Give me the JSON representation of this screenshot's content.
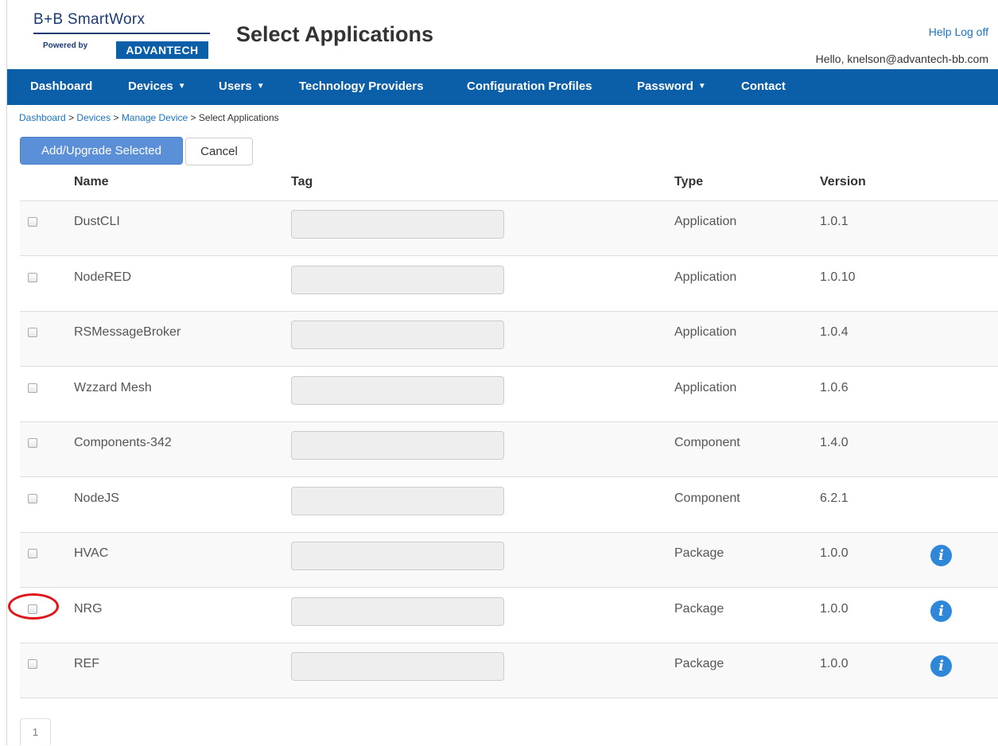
{
  "logo": {
    "brand": "B+B SmartWorx",
    "powered_by": "Powered by",
    "partner": "ADVANTECH"
  },
  "page_title": "Select Applications",
  "header_links": {
    "help": "Help",
    "logoff": "Log off"
  },
  "greeting": "Hello, knelson@advantech-bb.com",
  "nav": [
    {
      "label": "Dashboard",
      "dropdown": false
    },
    {
      "label": "Devices",
      "dropdown": true
    },
    {
      "label": "Users",
      "dropdown": true
    },
    {
      "label": "Technology Providers",
      "dropdown": false
    },
    {
      "label": "Configuration Profiles",
      "dropdown": false
    },
    {
      "label": "Password",
      "dropdown": true
    },
    {
      "label": "Contact",
      "dropdown": false
    }
  ],
  "breadcrumb": {
    "items": [
      "Dashboard",
      "Devices",
      "Manage Device"
    ],
    "current": "Select Applications",
    "separator": ">"
  },
  "toolbar": {
    "add_label": "Add/Upgrade Selected",
    "cancel_label": "Cancel"
  },
  "table": {
    "headers": {
      "name": "Name",
      "tag": "Tag",
      "type": "Type",
      "version": "Version"
    },
    "rows": [
      {
        "name": "DustCLI",
        "tag": "",
        "type": "Application",
        "version": "1.0.1",
        "info": false,
        "checked": false
      },
      {
        "name": "NodeRED",
        "tag": "",
        "type": "Application",
        "version": "1.0.10",
        "info": false,
        "checked": false
      },
      {
        "name": "RSMessageBroker",
        "tag": "",
        "type": "Application",
        "version": "1.0.4",
        "info": false,
        "checked": false
      },
      {
        "name": "Wzzard Mesh",
        "tag": "",
        "type": "Application",
        "version": "1.0.6",
        "info": false,
        "checked": false
      },
      {
        "name": "Components-342",
        "tag": "",
        "type": "Component",
        "version": "1.4.0",
        "info": false,
        "checked": false
      },
      {
        "name": "NodeJS",
        "tag": "",
        "type": "Component",
        "version": "6.2.1",
        "info": false,
        "checked": false
      },
      {
        "name": "HVAC",
        "tag": "",
        "type": "Package",
        "version": "1.0.0",
        "info": true,
        "checked": false
      },
      {
        "name": "NRG",
        "tag": "",
        "type": "Package",
        "version": "1.0.0",
        "info": true,
        "checked": false
      },
      {
        "name": "REF",
        "tag": "",
        "type": "Package",
        "version": "1.0.0",
        "info": true,
        "checked": false
      }
    ]
  },
  "pagination": {
    "current_page": "1"
  },
  "icons": {
    "info": "info-icon",
    "dropdown": "caret-down-icon"
  },
  "colors": {
    "navbar": "#0b5ea8",
    "link": "#1a73c4",
    "primary_button": "#5b8fd8",
    "info_icon": "#2f87d8",
    "annotation": "#e0161b"
  },
  "annotation": {
    "shape": "circle",
    "target": "NRG row checkbox"
  }
}
